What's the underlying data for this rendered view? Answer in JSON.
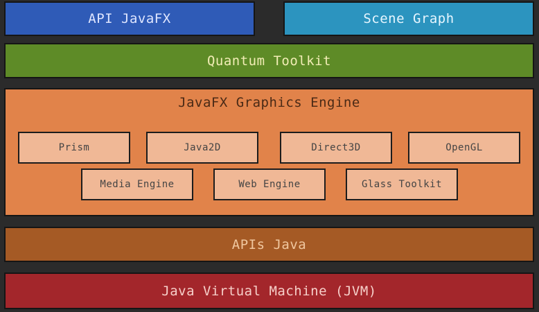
{
  "layers": {
    "api_javafx": "API JavaFX",
    "scene_graph": "Scene Graph",
    "quantum_toolkit": "Quantum Toolkit",
    "graphics_engine": {
      "title": "JavaFX Graphics Engine",
      "components_row1": [
        "Prism",
        "Java2D",
        "Direct3D",
        "OpenGL"
      ],
      "components_row2": [
        "Media Engine",
        "Web Engine",
        "Glass Toolkit"
      ]
    },
    "apis_java": "APIs Java",
    "jvm": "Java Virtual Machine (JVM)"
  },
  "colors": {
    "api_javafx": "#2f5bb7",
    "scene_graph": "#2c94bf",
    "quantum_toolkit": "#5e8b27",
    "graphics_engine": "#e1834a",
    "component": "#f0b896",
    "apis_java": "#a55a25",
    "jvm": "#a3262b"
  }
}
